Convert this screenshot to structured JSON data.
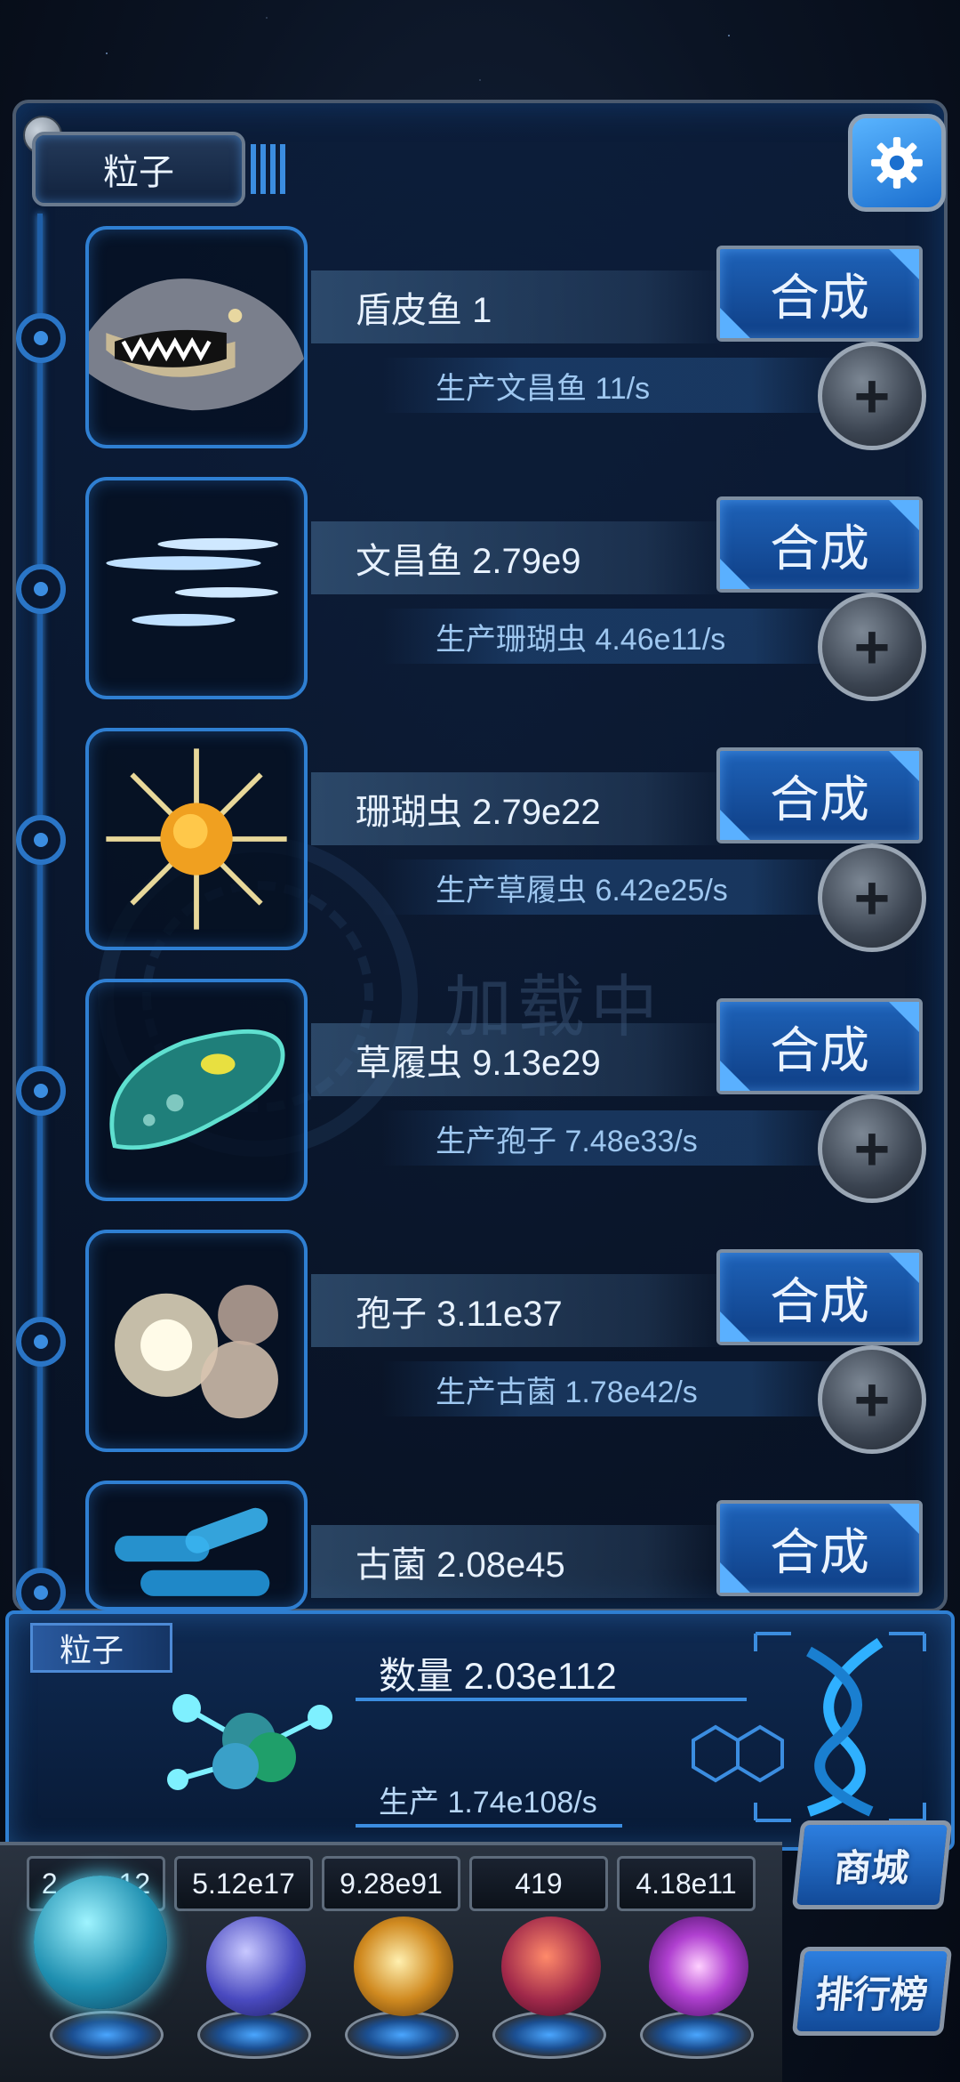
{
  "header": {
    "tab_label": "粒子"
  },
  "creatures": [
    {
      "name": "盾皮鱼 1",
      "production": "生产文昌鱼 11/s",
      "action": "合成",
      "icon": "dunkleosteus-fish"
    },
    {
      "name": "文昌鱼 2.79e9",
      "production": "生产珊瑚虫 4.46e11/s",
      "action": "合成",
      "icon": "lancelet-fish"
    },
    {
      "name": "珊瑚虫 2.79e22",
      "production": "生产草履虫 6.42e25/s",
      "action": "合成",
      "icon": "coral-polyp"
    },
    {
      "name": "草履虫 9.13e29",
      "production": "生产孢子 7.48e33/s",
      "action": "合成",
      "icon": "paramecium"
    },
    {
      "name": "孢子 3.11e37",
      "production": "生产古菌 1.78e42/s",
      "action": "合成",
      "icon": "spores"
    },
    {
      "name": "古菌 2.08e45",
      "production": "",
      "action": "合成",
      "icon": "archaea"
    }
  ],
  "watermark": "加载中",
  "particle_panel": {
    "label": "粒子",
    "count": "数量 2.03e112",
    "production": "生产 1.74e108/s"
  },
  "resources": [
    "2.",
    "5.12e17",
    "9.28e91",
    "419",
    "4.18e11"
  ],
  "resource_first_suffix": "12",
  "side_buttons": {
    "shop": "商城",
    "ranking": "排行榜"
  },
  "colors": {
    "accent": "#2f7fd2",
    "button": "#1e62b8",
    "text": "#e8f2ff"
  }
}
